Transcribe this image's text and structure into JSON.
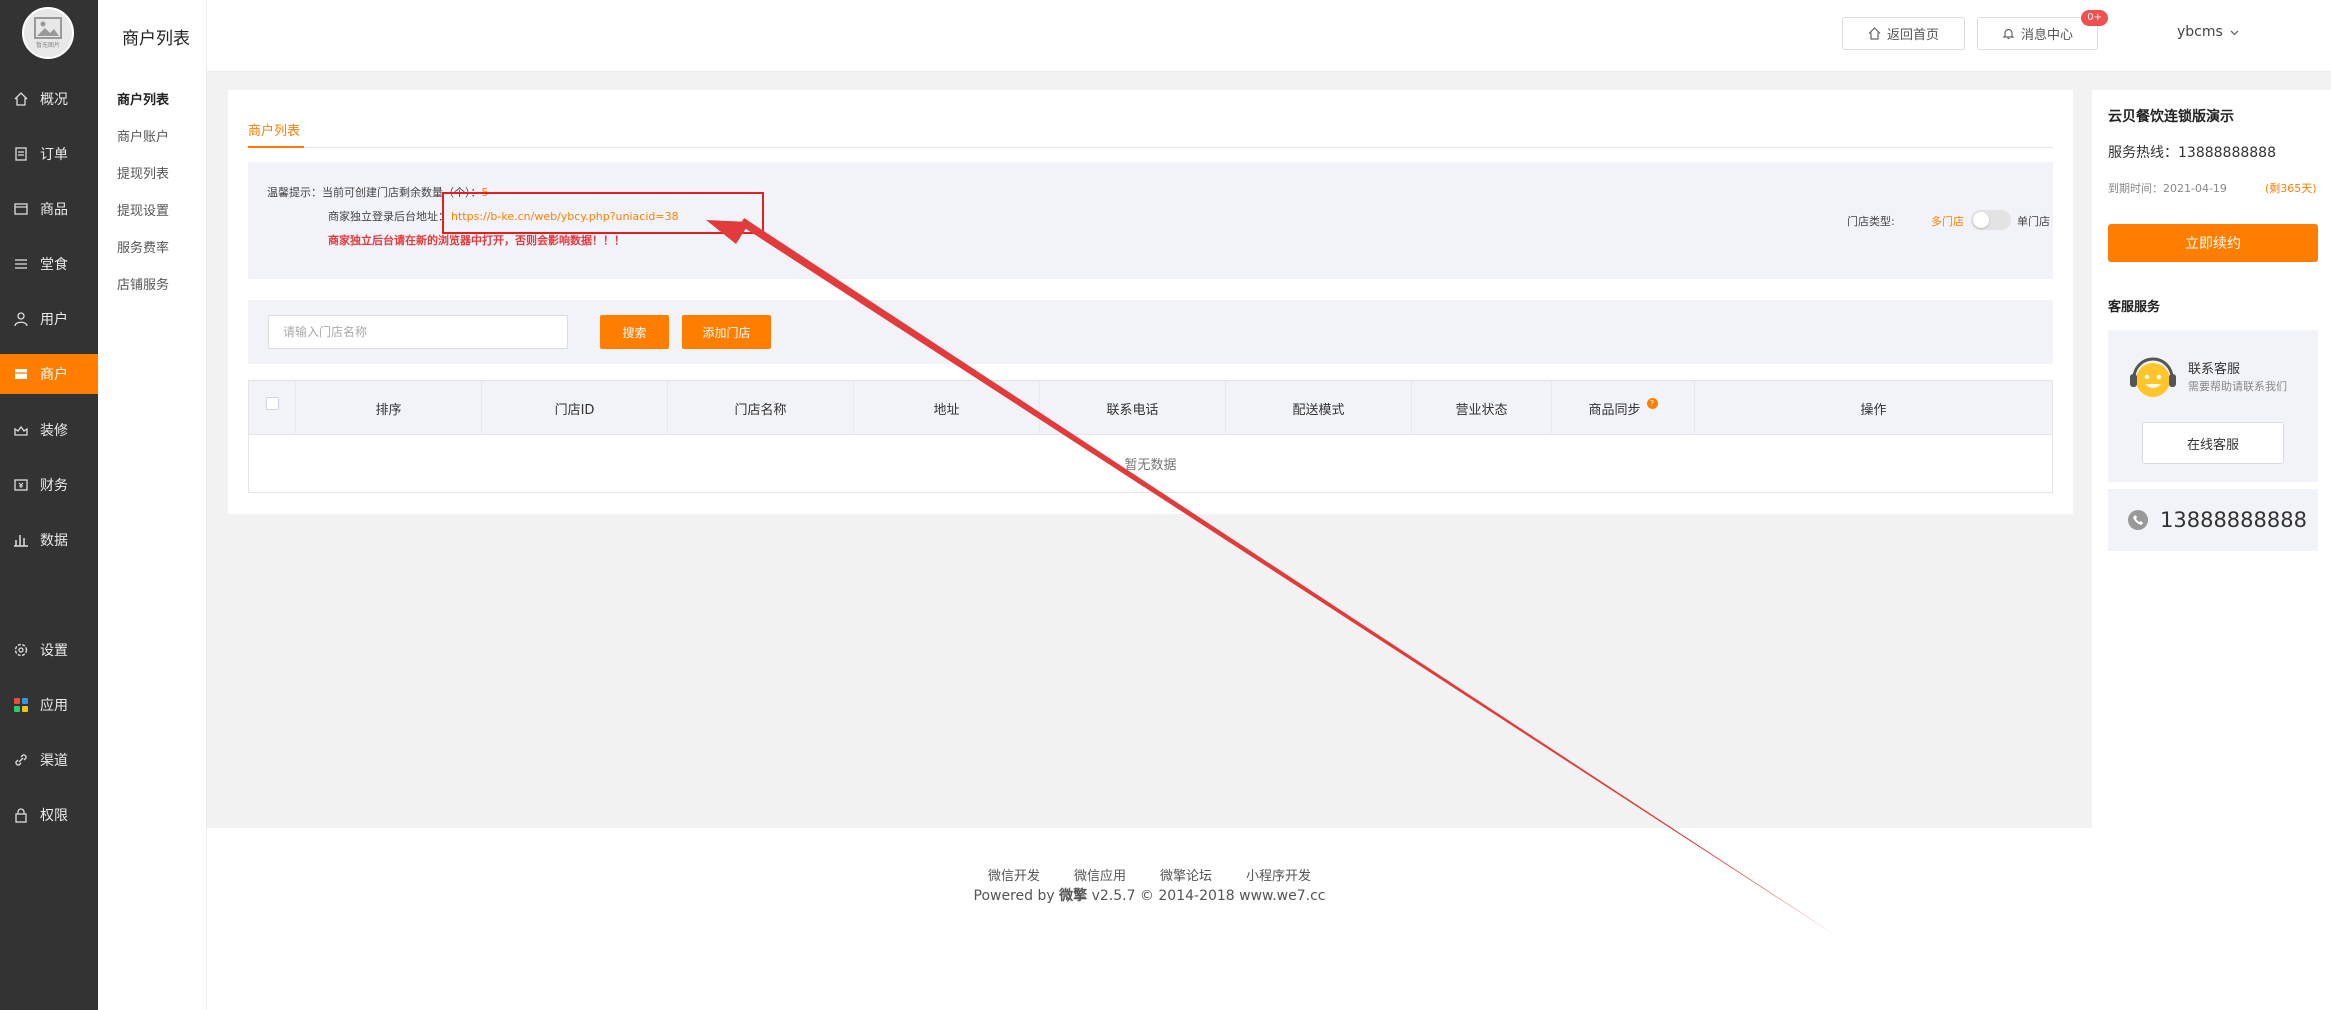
{
  "logo": {
    "caption": "暂无图片"
  },
  "nav": [
    {
      "label": "概况",
      "icon": "home-icon"
    },
    {
      "label": "订单",
      "icon": "order-icon"
    },
    {
      "label": "商品",
      "icon": "goods-icon"
    },
    {
      "label": "堂食",
      "icon": "menu-icon"
    },
    {
      "label": "用户",
      "icon": "user-icon"
    },
    {
      "label": "商户",
      "icon": "shop-icon",
      "active": true
    },
    {
      "label": "装修",
      "icon": "decorate-icon"
    },
    {
      "label": "财务",
      "icon": "finance-icon"
    },
    {
      "label": "数据",
      "icon": "chart-icon"
    },
    {
      "label": "设置",
      "icon": "gear-icon"
    },
    {
      "label": "应用",
      "icon": "apps-icon"
    },
    {
      "label": "渠道",
      "icon": "link-icon"
    },
    {
      "label": "权限",
      "icon": "lock-icon"
    }
  ],
  "subnav": {
    "title": "商户列表",
    "items": [
      "商户列表",
      "商户账户",
      "提现列表",
      "提现设置",
      "服务费率",
      "店铺服务"
    ]
  },
  "header": {
    "home_btn": "返回首页",
    "msg_btn": "消息中心",
    "msg_badge": "0+",
    "username": "ybcms"
  },
  "main": {
    "tab": "商户列表",
    "tip_line1_prefix": "温馨提示：当前可创建门店剩余数量（个）：",
    "tip_count": "5",
    "tip_line2_prefix": "商家独立登录后台地址：",
    "tip_url": "https://b-ke.cn/web/ybcy.php?uniacid=38",
    "tip_warning": "商家独立后台请在新的浏览器中打开，否则会影响数据！！！",
    "store_type_label": "门店类型:",
    "store_type_multi": "多门店",
    "store_type_single": "单门店",
    "search_placeholder": "请输入门店名称",
    "search_btn": "搜索",
    "add_btn": "添加门店",
    "columns": [
      "排序",
      "门店ID",
      "门店名称",
      "地址",
      "联系电话",
      "配送模式",
      "营业状态",
      "商品同步",
      "操作"
    ],
    "sync_help": "?",
    "empty_text": "暂无数据"
  },
  "right": {
    "title": "云贝餐饮连锁版演示",
    "hotline": "服务热线：13888888888",
    "expire": "到期时间：2021-04-19",
    "days_left": "(剩365天)",
    "renew_btn": "立即续约",
    "cs_title": "客服服务",
    "cs_name": "联系客服",
    "cs_sub": "需要帮助请联系我们",
    "cs_online": "在线客服",
    "phone": "13888888888"
  },
  "footer": {
    "links": [
      "微信开发",
      "微信应用",
      "微擎论坛",
      "小程序开发"
    ],
    "powered_prefix": "Powered by",
    "brand": "微擎",
    "powered_suffix": "v2.5.7 © 2014-2018 www.we7.cc"
  },
  "colors": {
    "accent": "#ff7e00",
    "sidebar": "#333333",
    "annotation": "#e02020"
  }
}
